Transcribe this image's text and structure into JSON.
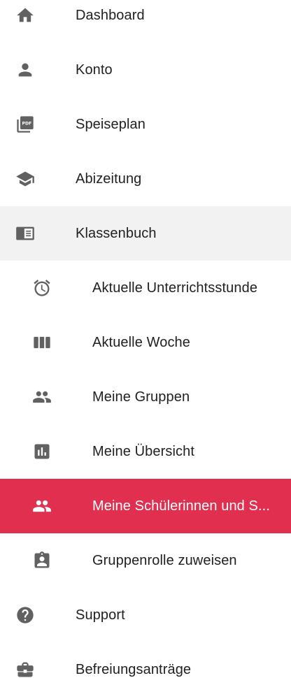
{
  "menu": {
    "items": [
      {
        "label": "Dashboard",
        "icon": "home-icon"
      },
      {
        "label": "Konto",
        "icon": "person-icon"
      },
      {
        "label": "Speiseplan",
        "icon": "pdf-icon"
      },
      {
        "label": "Abizeitung",
        "icon": "graduation-cap-icon"
      },
      {
        "label": "Klassenbuch",
        "icon": "book-icon",
        "expanded": true
      },
      {
        "label": "Aktuelle Unterrichtsstunde",
        "icon": "alarm-clock-icon"
      },
      {
        "label": "Aktuelle Woche",
        "icon": "week-columns-icon"
      },
      {
        "label": "Meine Gruppen",
        "icon": "people-icon"
      },
      {
        "label": "Meine Übersicht",
        "icon": "bar-chart-icon"
      },
      {
        "label": "Meine Schülerinnen und S...",
        "icon": "people-icon",
        "active": true
      },
      {
        "label": "Gruppenrolle zuweisen",
        "icon": "badge-icon"
      },
      {
        "label": "Support",
        "icon": "help-circle-icon"
      },
      {
        "label": "Befreiungsanträge",
        "icon": "briefcase-icon"
      }
    ]
  },
  "colors": {
    "active_background": "#e1304f",
    "expanded_background": "#f2f2f2",
    "icon": "#616161",
    "text": "#212121"
  }
}
